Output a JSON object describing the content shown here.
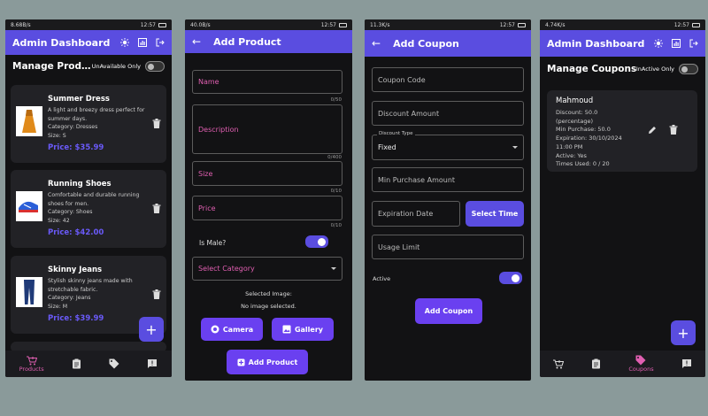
{
  "screens": {
    "products": {
      "status": {
        "speed": "8.68B/s",
        "time": "12:57"
      },
      "appbar_title": "Admin Dashboard",
      "manage_title": "Manage Prod…",
      "filter_label": "UnAvailable Only",
      "products": [
        {
          "name": "Summer Dress",
          "desc": "A light and breezy dress perfect for summer days.",
          "category": "Category: Dresses",
          "size": "Size: S",
          "price": "Price: $35.99"
        },
        {
          "name": "Running Shoes",
          "desc": "Comfortable and durable running shoes for men.",
          "category": "Category: Shoes",
          "size": "Size: 42",
          "price": "Price: $42.00"
        },
        {
          "name": "Skinny Jeans",
          "desc": "Stylish skinny jeans made with stretchable fabric.",
          "category": "Category: Jeans",
          "size": "Size: M",
          "price": "Price: $39.99"
        }
      ],
      "nav_active": "Products"
    },
    "add_product": {
      "status": {
        "speed": "40.0B/s",
        "time": "12:57"
      },
      "appbar_title": "Add Product",
      "fields": {
        "name": {
          "placeholder": "Name",
          "counter": "0/50"
        },
        "description": {
          "placeholder": "Description",
          "counter": "0/400"
        },
        "size": {
          "placeholder": "Size",
          "counter": "0/10"
        },
        "price": {
          "placeholder": "Price",
          "counter": "0/10"
        }
      },
      "is_male_label": "Is Male?",
      "category_placeholder": "Select Category",
      "selected_image_label": "Selected Image:",
      "no_image_text": "No image selected.",
      "camera_label": "Camera",
      "gallery_label": "Gallery",
      "submit_label": "Add Product"
    },
    "add_coupon": {
      "status": {
        "speed": "11.3K/s",
        "time": "12:57"
      },
      "appbar_title": "Add Coupon",
      "coupon_code_placeholder": "Coupon Code",
      "discount_amount_placeholder": "Discount Amount",
      "discount_type_label": "Discount Type",
      "discount_type_value": "Fixed",
      "min_purchase_placeholder": "Min Purchase Amount",
      "expiration_placeholder": "Expiration Date",
      "select_time_label": "Select Time",
      "usage_limit_placeholder": "Usage Limit",
      "active_label": "Active",
      "submit_label": "Add Coupon"
    },
    "coupons": {
      "status": {
        "speed": "4.74K/s",
        "time": "12:57"
      },
      "appbar_title": "Admin Dashboard",
      "manage_title": "Manage Coupons",
      "filter_label": "InActive Only",
      "coupon": {
        "name": "Mahmoud",
        "discount": "Discount: 50.0",
        "discount_type": "(percentage)",
        "min_purchase": "Min Purchase: 50.0",
        "expiration": "Expiration: 30/10/2024",
        "expiration_time": "11:00 PM",
        "active": "Active: Yes",
        "times_used": "Times Used: 0 / 20"
      },
      "nav_active": "Coupons"
    }
  },
  "colors": {
    "primary": "#5a4de0",
    "accent_pink": "#e05fb1",
    "price": "#6a5af9",
    "background": "#121214",
    "card": "#222226"
  },
  "icons": [
    "brightness-icon",
    "chart-icon",
    "logout-icon",
    "back-arrow-icon",
    "trash-icon",
    "edit-icon",
    "plus-icon",
    "cart-icon",
    "clipboard-icon",
    "tag-icon",
    "report-icon",
    "camera-icon",
    "gallery-icon",
    "add-box-icon",
    "chevron-down-icon"
  ]
}
